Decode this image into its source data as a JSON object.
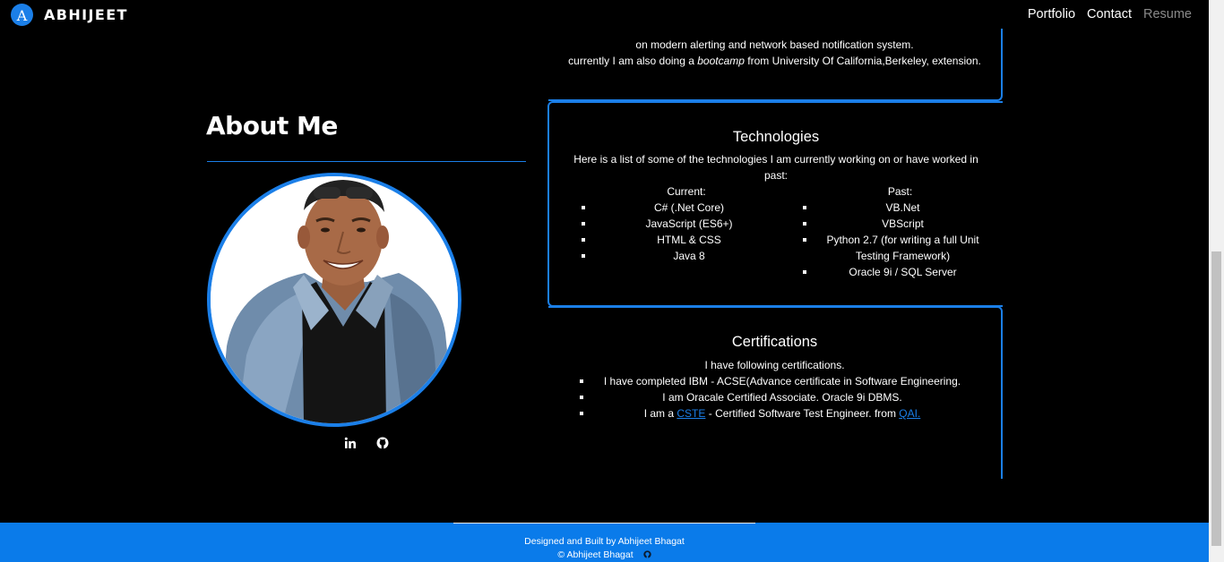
{
  "brand": {
    "logo_letter": "A",
    "name": "ABHIJEET"
  },
  "nav": {
    "portfolio": "Portfolio",
    "contact": "Contact",
    "resume": "Resume"
  },
  "intro": {
    "line1": "on modern alerting and network based notification system.",
    "line2_pre": "currently I am also doing a ",
    "line2_em": "bootcamp",
    "line2_post": " from University Of California,Berkeley, extension."
  },
  "about": {
    "title": "About Me",
    "social": [
      "linkedin-icon",
      "github-icon"
    ]
  },
  "technologies": {
    "title": "Technologies",
    "intro": "Here is a list of some of the technologies I am currently working on or have worked in past:",
    "current_label": "Current:",
    "current": [
      "C# (.Net Core)",
      "JavaScript (ES6+)",
      "HTML & CSS",
      "Java 8"
    ],
    "past_label": "Past:",
    "past": [
      "VB.Net",
      "VBScript",
      "Python 2.7 (for writing a full Unit Testing Framework)",
      "Oracle 9i / SQL Server"
    ]
  },
  "certifications": {
    "title": "Certifications",
    "intro": "I have following certifications.",
    "items": {
      "ibm": "I have completed IBM - ACSE(Advance certificate in Software Engineering.",
      "oracle": "I am Oracale Certified Associate. Oracle 9i DBMS.",
      "cste_pre": "I am a ",
      "cste_link": "CSTE",
      "cste_mid": " - Certified Software Test Engineer. from ",
      "qai_link": "QAI."
    }
  },
  "footer": {
    "line1": "Designed and Built by Abhijeet Bhagat",
    "line2": "© Abhijeet Bhagat"
  },
  "colors": {
    "accent": "#1b7fe8",
    "footer_bg": "#0a7bea",
    "page_bg": "#000000"
  }
}
